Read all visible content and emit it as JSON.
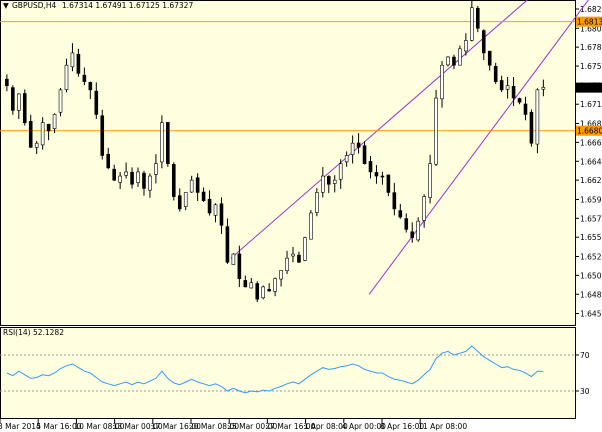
{
  "window": {
    "symbol_label": "GBPUSD,H4",
    "ohlc": "1.67314 1.67491 1.67125 1.67327"
  },
  "colors": {
    "background": "#ffffe0",
    "candle_up": "#000000",
    "candle_down": "#000000",
    "channel": "#9933cc",
    "hline": "#ff9900",
    "rsi_line": "#3399ff",
    "price_badge": "#000000",
    "hline_badge": "#ff9900"
  },
  "price_axis": {
    "ticks": [
      "1.68285",
      "1.68050",
      "1.67820",
      "1.67590",
      "1.67355",
      "1.67125",
      "1.66890",
      "1.66660",
      "1.66430",
      "1.66200",
      "1.65965",
      "1.65735",
      "1.65505",
      "1.65270",
      "1.65040",
      "1.64810",
      "1.64575"
    ],
    "current_price_label": "1.67327",
    "level1_label": "1.68131",
    "level2_label": "1.66802"
  },
  "time_axis": {
    "labels": [
      "3 Mar 2014",
      "5 Mar 16:00",
      "10 Mar 08:00",
      "13 Mar 00:00",
      "17 Mar 16:00",
      "20 Mar 08:00",
      "25 Mar 00:00",
      "27 Mar 16:00",
      "1 Apr 08:00",
      "4 Apr 00:00",
      "8 Apr 16:00",
      "11 Apr 08:00"
    ]
  },
  "rsi": {
    "title": "RSI(14) 52.1282",
    "ticks": [
      "70",
      "30"
    ],
    "top_label": "100",
    "bottom_label": "0"
  },
  "chart_data": {
    "type": "candlestick",
    "title": "GBPUSD,H4",
    "ylim": [
      1.6446,
      1.6837
    ],
    "horizontal_levels": [
      1.68131,
      1.66802
    ],
    "current_price": 1.67327,
    "close_approx": [
      1.6735,
      1.6705,
      1.6725,
      1.669,
      1.666,
      1.6665,
      1.669,
      1.668,
      1.67,
      1.673,
      1.676,
      1.6775,
      1.675,
      1.674,
      1.673,
      1.67,
      1.665,
      1.6635,
      1.662,
      1.6625,
      1.663,
      1.6615,
      1.663,
      1.661,
      1.6625,
      1.664,
      1.669,
      1.664,
      1.66,
      1.6585,
      1.6605,
      1.662,
      1.6605,
      1.6595,
      1.658,
      1.659,
      1.6565,
      1.652,
      1.653,
      1.65,
      1.649,
      1.6495,
      1.6475,
      1.649,
      1.6485,
      1.65,
      1.651,
      1.6525,
      1.653,
      1.652,
      1.655,
      1.658,
      1.6605,
      1.6625,
      1.6615,
      1.662,
      1.664,
      1.665,
      1.6665,
      1.666,
      1.664,
      1.663,
      1.6625,
      1.6625,
      1.6605,
      1.6585,
      1.6575,
      1.656,
      1.655,
      1.657,
      1.66,
      1.664,
      1.672,
      1.676,
      1.677,
      1.676,
      1.678,
      1.679,
      1.683,
      1.6805,
      1.6775,
      1.676,
      1.674,
      1.673,
      1.6735,
      1.672,
      1.6715,
      1.67,
      1.6665,
      1.673,
      1.6733
    ],
    "rsi_values": [
      50,
      47,
      52,
      48,
      44,
      45,
      48,
      47,
      50,
      55,
      58,
      60,
      56,
      52,
      50,
      45,
      40,
      38,
      36,
      38,
      40,
      37,
      40,
      38,
      41,
      44,
      52,
      44,
      39,
      37,
      40,
      43,
      40,
      38,
      36,
      38,
      35,
      30,
      33,
      30,
      28,
      30,
      29,
      31,
      30,
      33,
      35,
      38,
      40,
      38,
      43,
      48,
      52,
      56,
      54,
      55,
      57,
      58,
      60,
      58,
      54,
      52,
      50,
      50,
      46,
      43,
      42,
      40,
      38,
      42,
      48,
      54,
      66,
      72,
      74,
      70,
      72,
      74,
      80,
      74,
      68,
      64,
      60,
      56,
      57,
      54,
      53,
      50,
      46,
      52,
      52
    ]
  }
}
